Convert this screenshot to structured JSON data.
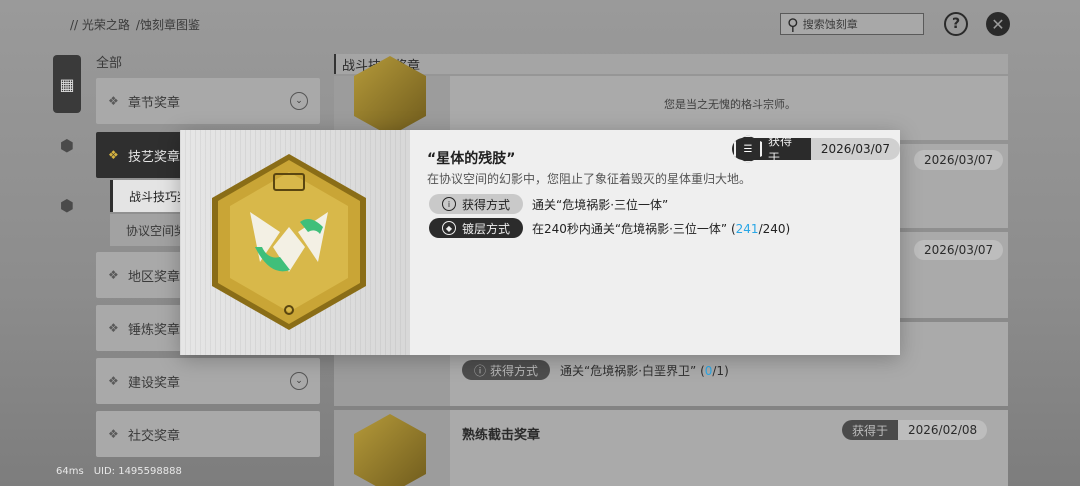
{
  "breadcrumb": [
    "// 光荣之路",
    "/蚀刻章图鉴"
  ],
  "search": {
    "placeholder": "搜索蚀刻章"
  },
  "top_icons": {
    "help": "?",
    "close": "✕"
  },
  "categories": {
    "all_label": "全部",
    "items": [
      {
        "label": "章节奖章",
        "icon": "medal-icon",
        "expandable": true
      },
      {
        "label": "技艺奖章",
        "icon": "skill-icon",
        "active": true
      },
      {
        "label": "地区奖章",
        "icon": "region-icon"
      },
      {
        "label": "锤炼奖章",
        "icon": "hammer-icon"
      },
      {
        "label": "建设奖章",
        "icon": "build-icon",
        "expandable": true
      },
      {
        "label": "社交奖章",
        "icon": "social-icon"
      }
    ],
    "sub_items": [
      {
        "label": "战斗技巧奖章",
        "active": true
      },
      {
        "label": "协议空间奖章"
      }
    ]
  },
  "section_title": "战斗技巧奖章",
  "cards": [
    {
      "desc": "您是当之无愧的格斗宗师。"
    },
    {
      "date": "2026/03/07"
    },
    {
      "date": "2026/03/07"
    },
    {
      "method_label": "获得方式",
      "method_text": "通关“危境祸影·白垩界卫”",
      "progress_current": "0",
      "progress_total": "/1"
    },
    {
      "title": "熟练截击奖章",
      "date_label": "获得于",
      "date": "2026/02/08"
    }
  ],
  "modal": {
    "title": "“星体的残肢”",
    "desc": "在协议空间的幻影中，您阻止了象征着毁灭的星体重归大地。",
    "obtain_label": "获得方式",
    "obtain_text": "通关“危境祸影·三位一体”",
    "plating_label": "镀层方式",
    "plating_text_prefix": "在240秒内通关“危境祸影·三位一体” (",
    "plating_current": "241",
    "plating_total": "/240)",
    "date_label": "获得于",
    "date": "2026/03/07"
  },
  "footer": {
    "ping": "64ms",
    "uid": "UID: 1495598888"
  },
  "colors": {
    "accent_blue": "#2aa7e6",
    "gold": "#c9a536",
    "green": "#3fbf7a"
  }
}
